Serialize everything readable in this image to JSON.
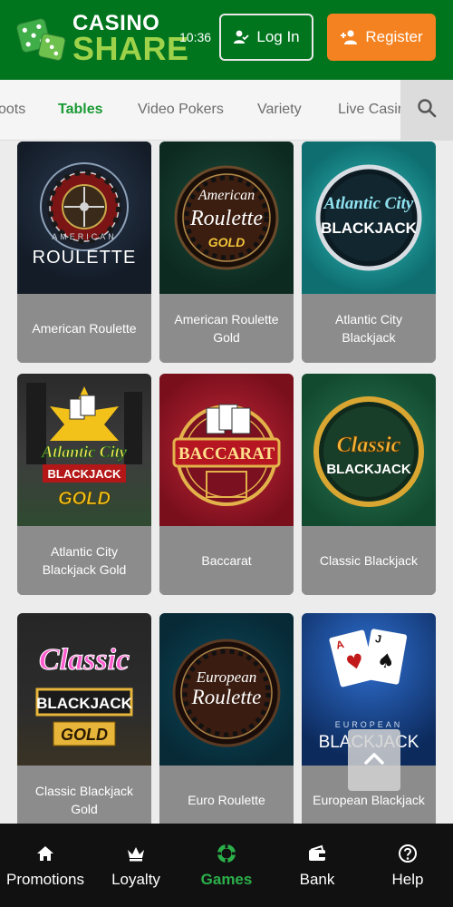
{
  "header": {
    "logo_top": "CASINO",
    "logo_bottom": "SHARE",
    "time": "10:36",
    "login_label": "Log In",
    "register_label": "Register"
  },
  "tabs": {
    "items": [
      "oots",
      "Tables",
      "Video Pokers",
      "Variety",
      "Live Casir"
    ],
    "active": "Tables"
  },
  "games": [
    {
      "title": "American Roulette",
      "art": [
        "AMERICAN",
        "ROULETTE"
      ]
    },
    {
      "title": "American Roulette Gold",
      "art": [
        "American",
        "Roulette",
        "GOLD"
      ]
    },
    {
      "title": "Atlantic City Blackjack",
      "art": [
        "Atlantic City",
        "BLACKJACK"
      ]
    },
    {
      "title": "Atlantic City Blackjack Gold",
      "art": [
        "Atlantic City",
        "BLACKJACK",
        "GOLD"
      ]
    },
    {
      "title": "Baccarat",
      "art": [
        "BACCARAT"
      ]
    },
    {
      "title": "Classic Blackjack",
      "art": [
        "Classic",
        "BLACKJACK"
      ]
    },
    {
      "title": "Classic Blackjack Gold",
      "art": [
        "Classic",
        "BLACKJACK",
        "GOLD"
      ]
    },
    {
      "title": "Euro Roulette",
      "art": [
        "European",
        "Roulette"
      ]
    },
    {
      "title": "European Blackjack",
      "art": [
        "EUROPEAN",
        "BLACKJACK"
      ]
    }
  ],
  "bottom_nav": {
    "items": [
      "Promotions",
      "Loyalty",
      "Games",
      "Bank",
      "Help"
    ],
    "active": "Games"
  },
  "colors": {
    "header_green": "#00751e",
    "accent_orange": "#f58220",
    "active_green": "#1a9a34",
    "logo_lime": "#9ed24a"
  },
  "icons": {
    "login": "user-check-icon",
    "register": "user-plus-icon",
    "search": "search-icon",
    "scroll_top": "chevron-up-icon"
  }
}
